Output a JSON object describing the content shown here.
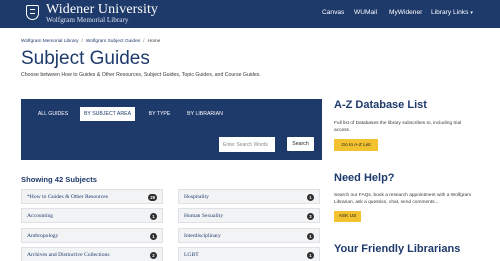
{
  "header": {
    "brand_name": "Widener University",
    "brand_subtitle": "Wolfgram Memorial Library",
    "nav": {
      "canvas": "Canvas",
      "wumail": "WUMail",
      "mywidener": "MyWidener",
      "library_links": "Library Links"
    },
    "colors": {
      "header_bg": "#1e3a6b",
      "accent": "#f2c230"
    }
  },
  "breadcrumb": [
    "Wolfgram Memorial Library",
    "Wolfgram Subject Guides",
    "Home"
  ],
  "page": {
    "title": "Subject Guides",
    "description": "Choose between How to Guides & Other Resources, Subject Guides, Topic Guides, and Course Guides."
  },
  "filter": {
    "tabs": [
      "ALL GUIDES",
      "BY SUBJECT AREA",
      "BY TYPE",
      "BY LIBRARIAN"
    ],
    "active_tab": "BY SUBJECT AREA",
    "search_label": "Search",
    "search_placeholder": "Enter Search Words",
    "search_button": "Search"
  },
  "subjects": {
    "heading": "Showing 42 Subjects",
    "items": [
      {
        "name": "*How to Guides & Other Resources",
        "count": "29"
      },
      {
        "name": "Hospitality",
        "count": "1"
      },
      {
        "name": "Accounting",
        "count": "1"
      },
      {
        "name": "Human Sexuality",
        "count": "3"
      },
      {
        "name": "Anthropology",
        "count": "1"
      },
      {
        "name": "Interdisciplinary",
        "count": "1"
      },
      {
        "name": "Archives and Distinctive Collections",
        "count": "2"
      },
      {
        "name": "LGBT",
        "count": "1"
      }
    ]
  },
  "sidebar": {
    "az": {
      "title": "A-Z Database List",
      "text": "Full list of Databases the library subscribes to, including trial access.",
      "button": "Go to A-Z List"
    },
    "help": {
      "title": "Need Help?",
      "text": "Search our FAQs, book a research appointment with a Wolfgram Librarian, ask a question, chat, send comments...",
      "button": "ASK US"
    },
    "librarians": {
      "title": "Your Friendly Librarians"
    }
  }
}
